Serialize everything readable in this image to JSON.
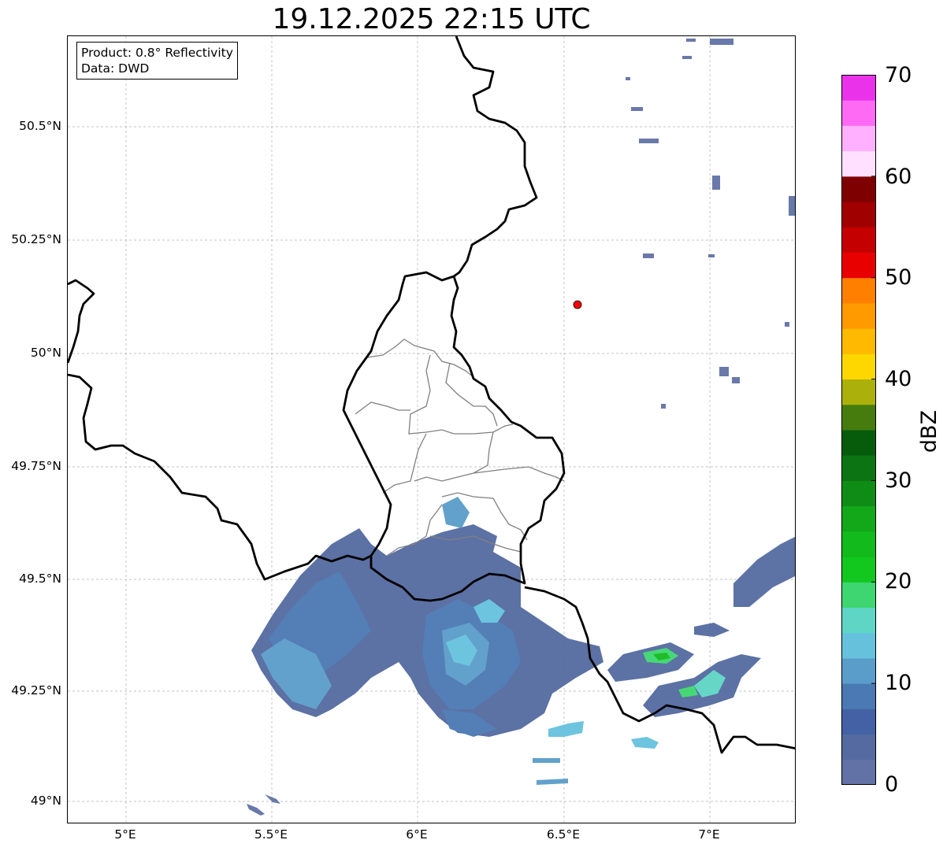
{
  "title": "19.12.2025 22:15 UTC",
  "info": {
    "product": "Product: 0.8° Reflectivity",
    "source": "Data: DWD"
  },
  "lat_ticks": [
    "50.5°N",
    "50.25°N",
    "50°N",
    "49.75°N",
    "49.5°N",
    "49.25°N",
    "49°N"
  ],
  "lon_ticks": [
    "5°E",
    "5.5°E",
    "6°E",
    "6.5°E",
    "7°E"
  ],
  "colorbar": {
    "label": "dBZ",
    "ticks": [
      "0",
      "10",
      "20",
      "30",
      "40",
      "50",
      "60",
      "70"
    ],
    "colors": [
      "#6272a6",
      "#546aa0",
      "#4461a6",
      "#4a79b3",
      "#5a9dca",
      "#66c1dd",
      "#5ed5c5",
      "#3dd670",
      "#12c71e",
      "#12ba1c",
      "#12a81a",
      "#0f8c15",
      "#0c7412",
      "#075c0c",
      "#467c0e",
      "#acb00a",
      "#ffd700",
      "#ffb900",
      "#ff9a00",
      "#ff7f00",
      "#e80000",
      "#c40000",
      "#a00000",
      "#7f0000",
      "#ffe0ff",
      "#ffb0ff",
      "#ff6af5",
      "#eb32eb"
    ]
  },
  "map_style": {
    "country_border": "#000000",
    "district_border": "#808080",
    "gridline": "#b0b0b0",
    "radar_site_color": "#ff0000"
  },
  "radar_site": {
    "lon": 6.55,
    "lat": 50.11
  }
}
